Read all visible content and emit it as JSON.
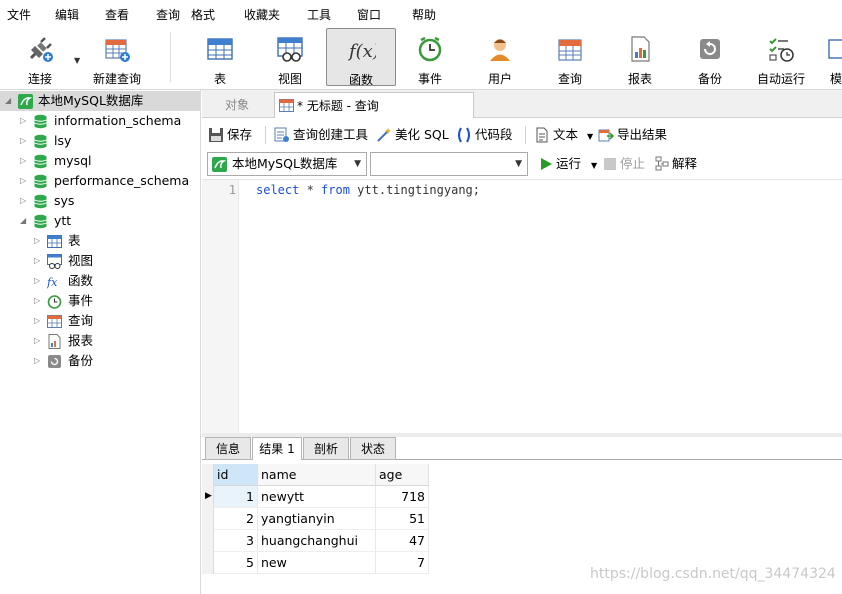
{
  "menu": [
    "文件",
    "编辑",
    "查看",
    "查询",
    "格式",
    "收藏夹",
    "工具",
    "窗口",
    "帮助"
  ],
  "toolbar": {
    "connect": "连接",
    "new_query": "新建查询",
    "table": "表",
    "view": "视图",
    "function": "函数",
    "event": "事件",
    "user": "用户",
    "query": "查询",
    "report": "报表",
    "backup": "备份",
    "schedule": "自动运行",
    "more": "模"
  },
  "sidebar": {
    "connection": "本地MySQL数据库",
    "databases": [
      "information_schema",
      "lsy",
      "mysql",
      "performance_schema",
      "sys",
      "ytt"
    ],
    "ytt_children": [
      "表",
      "视图",
      "函数",
      "事件",
      "查询",
      "报表",
      "备份"
    ]
  },
  "tabs": {
    "objects": "对象",
    "query_tab": "* 无标题 - 查询"
  },
  "query_toolbar": {
    "save": "保存",
    "builder": "查询创建工具",
    "beautify": "美化 SQL",
    "snippet": "代码段",
    "text": "文本",
    "export": "导出结果"
  },
  "db_bar": {
    "connection": "本地MySQL数据库",
    "database": "",
    "run": "运行",
    "stop": "停止",
    "explain": "解释"
  },
  "editor": {
    "line_number": "1",
    "kw_select": "select",
    "star": " * ",
    "kw_from": "from",
    "target": " ytt.tingtingyang;"
  },
  "result_tabs": [
    "信息",
    "结果 1",
    "剖析",
    "状态"
  ],
  "result_grid": {
    "columns": [
      "id",
      "name",
      "age"
    ],
    "rows": [
      {
        "id": "1",
        "name": "newytt",
        "age": "718"
      },
      {
        "id": "2",
        "name": "yangtianyin",
        "age": "51"
      },
      {
        "id": "3",
        "name": "huangchanghui",
        "age": "47"
      },
      {
        "id": "5",
        "name": "new",
        "age": "7"
      }
    ]
  },
  "watermark": "https://blog.csdn.net/qq_34474324",
  "colors": {
    "keyword": "#1a4fd6",
    "db_icon": "#2ea84a",
    "selected_header": "#cfe6f8",
    "run_green": "#2a9a2a"
  }
}
